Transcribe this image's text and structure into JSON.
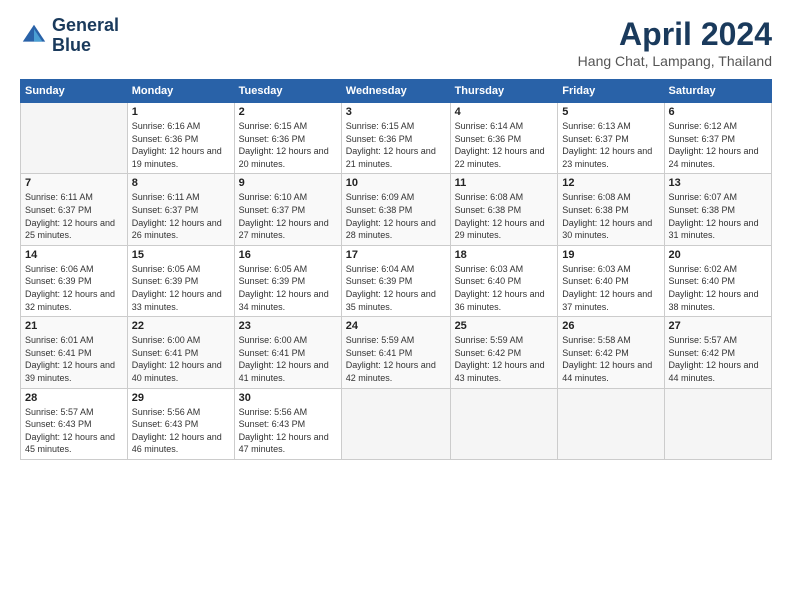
{
  "logo": {
    "line1": "General",
    "line2": "Blue"
  },
  "title": "April 2024",
  "subtitle": "Hang Chat, Lampang, Thailand",
  "days_header": [
    "Sunday",
    "Monday",
    "Tuesday",
    "Wednesday",
    "Thursday",
    "Friday",
    "Saturday"
  ],
  "weeks": [
    [
      {
        "num": "",
        "sunrise": "",
        "sunset": "",
        "daylight": "",
        "empty": true
      },
      {
        "num": "1",
        "sunrise": "Sunrise: 6:16 AM",
        "sunset": "Sunset: 6:36 PM",
        "daylight": "Daylight: 12 hours and 19 minutes."
      },
      {
        "num": "2",
        "sunrise": "Sunrise: 6:15 AM",
        "sunset": "Sunset: 6:36 PM",
        "daylight": "Daylight: 12 hours and 20 minutes."
      },
      {
        "num": "3",
        "sunrise": "Sunrise: 6:15 AM",
        "sunset": "Sunset: 6:36 PM",
        "daylight": "Daylight: 12 hours and 21 minutes."
      },
      {
        "num": "4",
        "sunrise": "Sunrise: 6:14 AM",
        "sunset": "Sunset: 6:36 PM",
        "daylight": "Daylight: 12 hours and 22 minutes."
      },
      {
        "num": "5",
        "sunrise": "Sunrise: 6:13 AM",
        "sunset": "Sunset: 6:37 PM",
        "daylight": "Daylight: 12 hours and 23 minutes."
      },
      {
        "num": "6",
        "sunrise": "Sunrise: 6:12 AM",
        "sunset": "Sunset: 6:37 PM",
        "daylight": "Daylight: 12 hours and 24 minutes."
      }
    ],
    [
      {
        "num": "7",
        "sunrise": "Sunrise: 6:11 AM",
        "sunset": "Sunset: 6:37 PM",
        "daylight": "Daylight: 12 hours and 25 minutes."
      },
      {
        "num": "8",
        "sunrise": "Sunrise: 6:11 AM",
        "sunset": "Sunset: 6:37 PM",
        "daylight": "Daylight: 12 hours and 26 minutes."
      },
      {
        "num": "9",
        "sunrise": "Sunrise: 6:10 AM",
        "sunset": "Sunset: 6:37 PM",
        "daylight": "Daylight: 12 hours and 27 minutes."
      },
      {
        "num": "10",
        "sunrise": "Sunrise: 6:09 AM",
        "sunset": "Sunset: 6:38 PM",
        "daylight": "Daylight: 12 hours and 28 minutes."
      },
      {
        "num": "11",
        "sunrise": "Sunrise: 6:08 AM",
        "sunset": "Sunset: 6:38 PM",
        "daylight": "Daylight: 12 hours and 29 minutes."
      },
      {
        "num": "12",
        "sunrise": "Sunrise: 6:08 AM",
        "sunset": "Sunset: 6:38 PM",
        "daylight": "Daylight: 12 hours and 30 minutes."
      },
      {
        "num": "13",
        "sunrise": "Sunrise: 6:07 AM",
        "sunset": "Sunset: 6:38 PM",
        "daylight": "Daylight: 12 hours and 31 minutes."
      }
    ],
    [
      {
        "num": "14",
        "sunrise": "Sunrise: 6:06 AM",
        "sunset": "Sunset: 6:39 PM",
        "daylight": "Daylight: 12 hours and 32 minutes."
      },
      {
        "num": "15",
        "sunrise": "Sunrise: 6:05 AM",
        "sunset": "Sunset: 6:39 PM",
        "daylight": "Daylight: 12 hours and 33 minutes."
      },
      {
        "num": "16",
        "sunrise": "Sunrise: 6:05 AM",
        "sunset": "Sunset: 6:39 PM",
        "daylight": "Daylight: 12 hours and 34 minutes."
      },
      {
        "num": "17",
        "sunrise": "Sunrise: 6:04 AM",
        "sunset": "Sunset: 6:39 PM",
        "daylight": "Daylight: 12 hours and 35 minutes."
      },
      {
        "num": "18",
        "sunrise": "Sunrise: 6:03 AM",
        "sunset": "Sunset: 6:40 PM",
        "daylight": "Daylight: 12 hours and 36 minutes."
      },
      {
        "num": "19",
        "sunrise": "Sunrise: 6:03 AM",
        "sunset": "Sunset: 6:40 PM",
        "daylight": "Daylight: 12 hours and 37 minutes."
      },
      {
        "num": "20",
        "sunrise": "Sunrise: 6:02 AM",
        "sunset": "Sunset: 6:40 PM",
        "daylight": "Daylight: 12 hours and 38 minutes."
      }
    ],
    [
      {
        "num": "21",
        "sunrise": "Sunrise: 6:01 AM",
        "sunset": "Sunset: 6:41 PM",
        "daylight": "Daylight: 12 hours and 39 minutes."
      },
      {
        "num": "22",
        "sunrise": "Sunrise: 6:00 AM",
        "sunset": "Sunset: 6:41 PM",
        "daylight": "Daylight: 12 hours and 40 minutes."
      },
      {
        "num": "23",
        "sunrise": "Sunrise: 6:00 AM",
        "sunset": "Sunset: 6:41 PM",
        "daylight": "Daylight: 12 hours and 41 minutes."
      },
      {
        "num": "24",
        "sunrise": "Sunrise: 5:59 AM",
        "sunset": "Sunset: 6:41 PM",
        "daylight": "Daylight: 12 hours and 42 minutes."
      },
      {
        "num": "25",
        "sunrise": "Sunrise: 5:59 AM",
        "sunset": "Sunset: 6:42 PM",
        "daylight": "Daylight: 12 hours and 43 minutes."
      },
      {
        "num": "26",
        "sunrise": "Sunrise: 5:58 AM",
        "sunset": "Sunset: 6:42 PM",
        "daylight": "Daylight: 12 hours and 44 minutes."
      },
      {
        "num": "27",
        "sunrise": "Sunrise: 5:57 AM",
        "sunset": "Sunset: 6:42 PM",
        "daylight": "Daylight: 12 hours and 44 minutes."
      }
    ],
    [
      {
        "num": "28",
        "sunrise": "Sunrise: 5:57 AM",
        "sunset": "Sunset: 6:43 PM",
        "daylight": "Daylight: 12 hours and 45 minutes."
      },
      {
        "num": "29",
        "sunrise": "Sunrise: 5:56 AM",
        "sunset": "Sunset: 6:43 PM",
        "daylight": "Daylight: 12 hours and 46 minutes."
      },
      {
        "num": "30",
        "sunrise": "Sunrise: 5:56 AM",
        "sunset": "Sunset: 6:43 PM",
        "daylight": "Daylight: 12 hours and 47 minutes."
      },
      {
        "num": "",
        "sunrise": "",
        "sunset": "",
        "daylight": "",
        "empty": true
      },
      {
        "num": "",
        "sunrise": "",
        "sunset": "",
        "daylight": "",
        "empty": true
      },
      {
        "num": "",
        "sunrise": "",
        "sunset": "",
        "daylight": "",
        "empty": true
      },
      {
        "num": "",
        "sunrise": "",
        "sunset": "",
        "daylight": "",
        "empty": true
      }
    ]
  ]
}
